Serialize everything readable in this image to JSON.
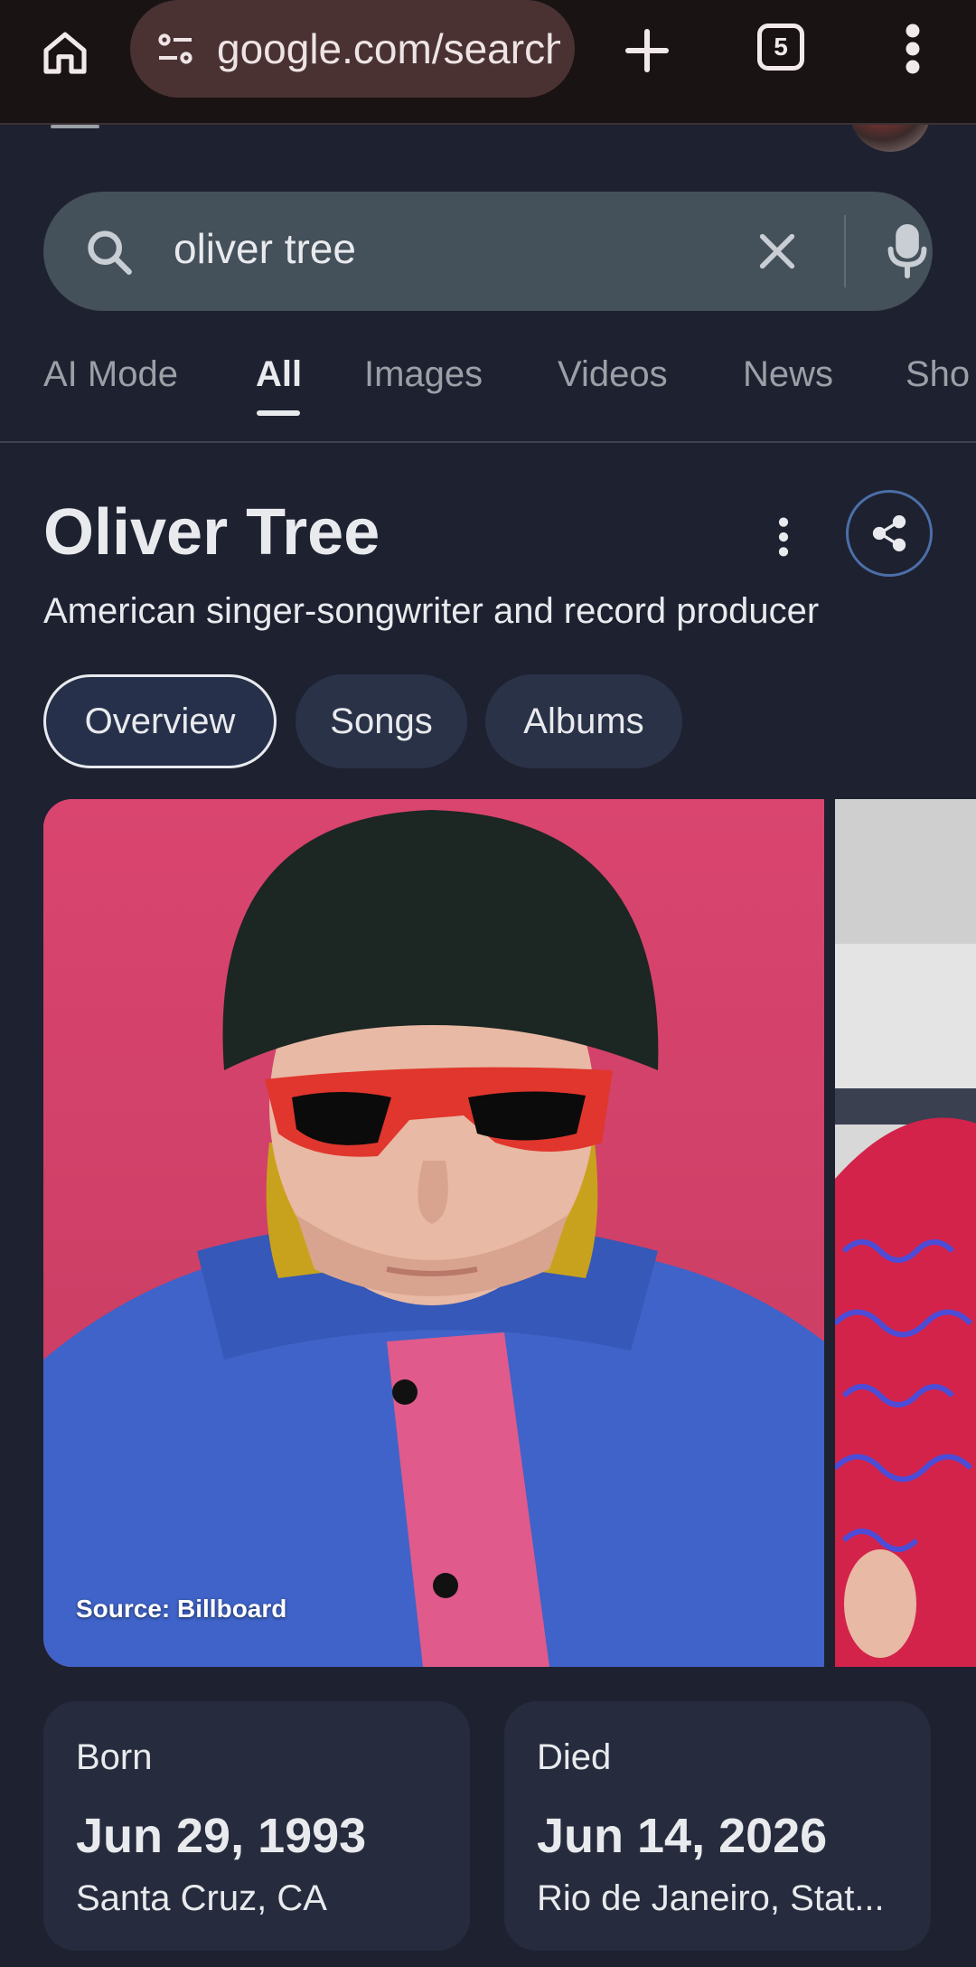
{
  "browser": {
    "url": "google.com/search",
    "tab_count": "5"
  },
  "search": {
    "query": "oliver tree"
  },
  "tabs": [
    {
      "label": "AI Mode"
    },
    {
      "label": "All"
    },
    {
      "label": "Images"
    },
    {
      "label": "Videos"
    },
    {
      "label": "News"
    },
    {
      "label": "Sho"
    }
  ],
  "active_tab": "All",
  "knowledge_panel": {
    "title": "Oliver Tree",
    "subtitle": "American singer-songwriter and record producer",
    "chips": [
      {
        "label": "Overview"
      },
      {
        "label": "Songs"
      },
      {
        "label": "Albums"
      }
    ],
    "image_source": "Source: Billboard",
    "born": {
      "label": "Born",
      "date": "Jun 29, 1993",
      "place": "Santa Cruz, CA"
    },
    "died": {
      "label": "Died",
      "date": "Jun 14, 2026",
      "place": "Rio de Janeiro, Stat..."
    }
  },
  "icons": {
    "home": "home-icon",
    "site_info": "tune-icon",
    "new_tab": "plus-icon",
    "tab_switcher": "tabs-icon",
    "menu": "more-vert-icon",
    "search": "search-icon",
    "clear": "close-icon",
    "mic": "mic-icon",
    "share": "share-icon"
  },
  "colors": {
    "page_bg": "#1e2130",
    "chrome_bg": "#1a1313",
    "urlbar_bg": "#4a3233",
    "searchbox_bg": "#44505a",
    "chip_bg": "#2a3248",
    "card_bg": "#262c3d",
    "share_ring": "#4b6fa8",
    "photo_bg": "#d6416e"
  }
}
